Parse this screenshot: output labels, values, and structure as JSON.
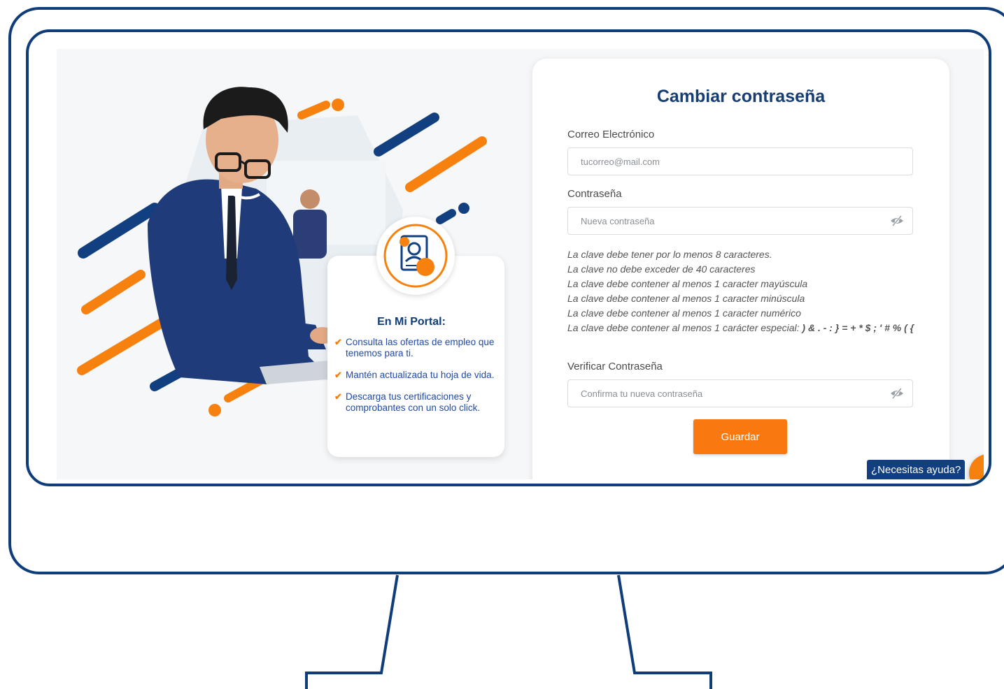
{
  "portal": {
    "title": "En Mi Portal:",
    "items": [
      "Consulta las ofertas de empleo que tenemos para ti.",
      "Mantén actualizada tu hoja de vida.",
      "Descarga tus certificaciones y comprobantes con un solo click."
    ]
  },
  "form": {
    "title": "Cambiar contraseña",
    "email_label": "Correo Electrónico",
    "email_placeholder": "tucorreo@mail.com",
    "password_label": "Contraseña",
    "password_placeholder": "Nueva contraseña",
    "rules": [
      "La clave debe tener por lo menos 8 caracteres.",
      "La clave no debe exceder de 40 caracteres",
      "La clave debe contener al menos 1 caracter mayúscula",
      "La clave debe contener al menos 1 caracter minúscula",
      "La clave debe contener al menos 1 caracter numérico"
    ],
    "special_rule_text": "La clave debe contener al menos 1 carácter especial: ",
    "special_chars": ") & . - : } = + * $ ; ' # % ( {",
    "verify_label": "Verificar Contraseña",
    "verify_placeholder": "Confirma tu nueva contraseña",
    "save_label": "Guardar"
  },
  "help": {
    "label": "¿Necesitas ayuda?",
    "fab_symbol": "+"
  },
  "colors": {
    "frame": "#0f3d7a",
    "accent": "#f97910",
    "title": "#163e74"
  },
  "icons": [
    "eye-slash-icon",
    "check-icon",
    "plus-icon",
    "profile-document-icon"
  ]
}
